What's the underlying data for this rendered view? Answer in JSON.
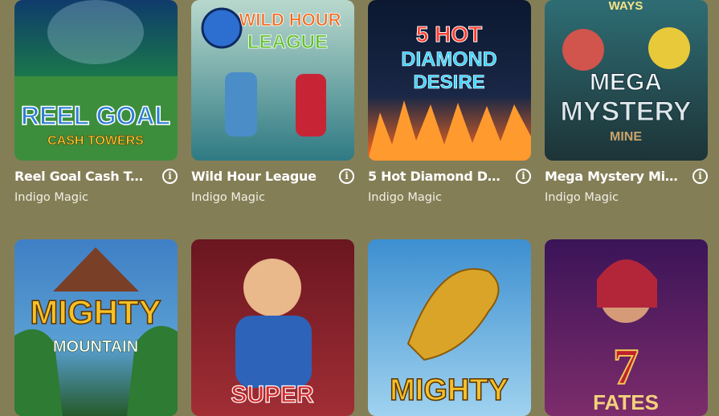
{
  "games": [
    {
      "title": "Reel Goal Cash To...",
      "provider": "Indigo Magic",
      "art": [
        "REEL GOAL",
        "CASH TOWERS"
      ],
      "colors": [
        "#1b7a4a",
        "#4ca24a"
      ]
    },
    {
      "title": "Wild Hour League",
      "provider": "Indigo Magic",
      "art": [
        "WILD HOUR",
        "LEAGUE"
      ],
      "colors": [
        "#2f7a83",
        "#6ab0a8"
      ]
    },
    {
      "title": "5 Hot Diamond Des...",
      "provider": "Indigo Magic",
      "art": [
        "5 HOT",
        "DIAMOND",
        "DESIRE"
      ],
      "colors": [
        "#0b1830",
        "#ff6b1c"
      ]
    },
    {
      "title": "Mega Mystery Mine",
      "provider": "Indigo Magic",
      "art": [
        "WAYS",
        "MEGA",
        "MYSTERY",
        "MINE"
      ],
      "colors": [
        "#2e6d74",
        "#1d3437"
      ]
    },
    {
      "title": "",
      "provider": "",
      "art": [
        "MIGHTY",
        "MOUNTAIN"
      ],
      "colors": [
        "#3f7fc4",
        "#245a2a"
      ]
    },
    {
      "title": "",
      "provider": "",
      "art": [
        "SUPER"
      ],
      "colors": [
        "#6a1620",
        "#a12e35"
      ]
    },
    {
      "title": "",
      "provider": "",
      "art": [
        "MIGHTY"
      ],
      "colors": [
        "#3d8fd0",
        "#9fd2ef"
      ]
    },
    {
      "title": "",
      "provider": "",
      "art": [
        "7",
        "FATES"
      ],
      "colors": [
        "#3a1458",
        "#7d2c6b"
      ]
    }
  ],
  "info_glyph": "i"
}
